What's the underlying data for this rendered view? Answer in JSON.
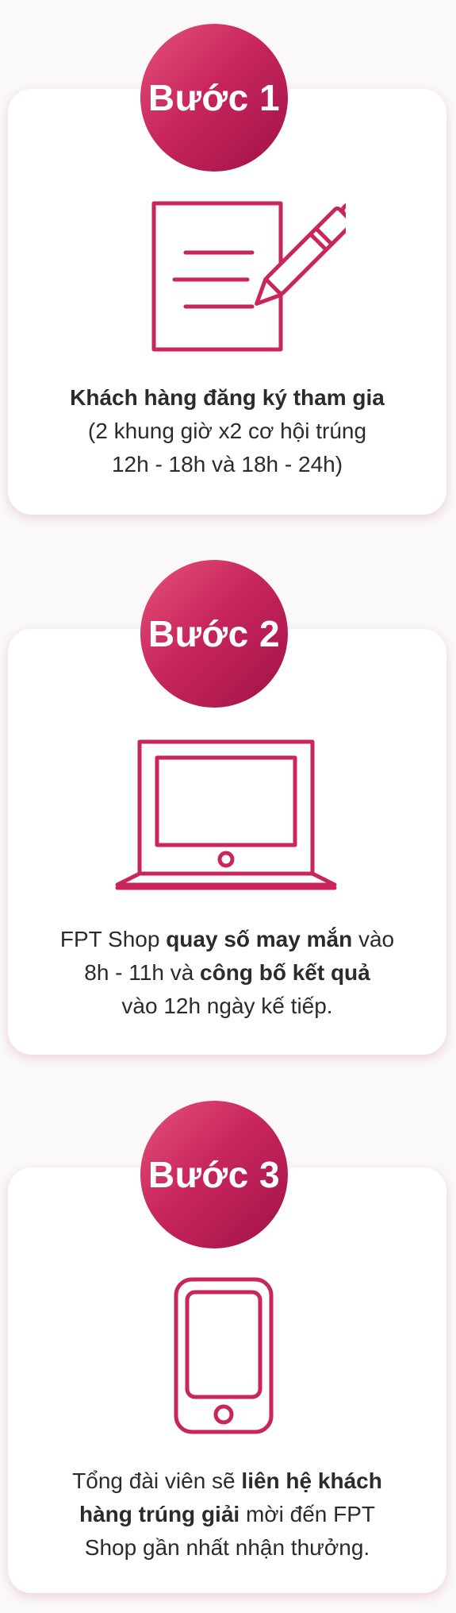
{
  "colors": {
    "accent": "#c8265c",
    "accent_dark": "#a01248",
    "card_bg": "#ffffff",
    "text": "#2b2b2b"
  },
  "steps": [
    {
      "badge": "Bước 1",
      "icon": "document-pen-icon",
      "line1_bold": "Khách hàng đăng ký tham gia",
      "line2": "(2 khung giờ x2 cơ hội trúng",
      "line3": "12h - 18h và 18h - 24h)"
    },
    {
      "badge": "Bước 2",
      "icon": "laptop-icon",
      "line1_a": "FPT Shop ",
      "line1_bold": "quay số may mắn",
      "line1_b": " vào",
      "line2_a": "8h - 11h và ",
      "line2_bold": "công bố kết quả",
      "line3": "vào 12h ngày kế tiếp."
    },
    {
      "badge": "Bước 3",
      "icon": "smartphone-icon",
      "line1_a": "Tổng đài viên sẽ ",
      "line1_bold": "liên hệ khách",
      "line2_bold": "hàng trúng giải",
      "line2_a": " mời đến FPT",
      "line3": "Shop gần nhất nhận thưởng."
    }
  ]
}
